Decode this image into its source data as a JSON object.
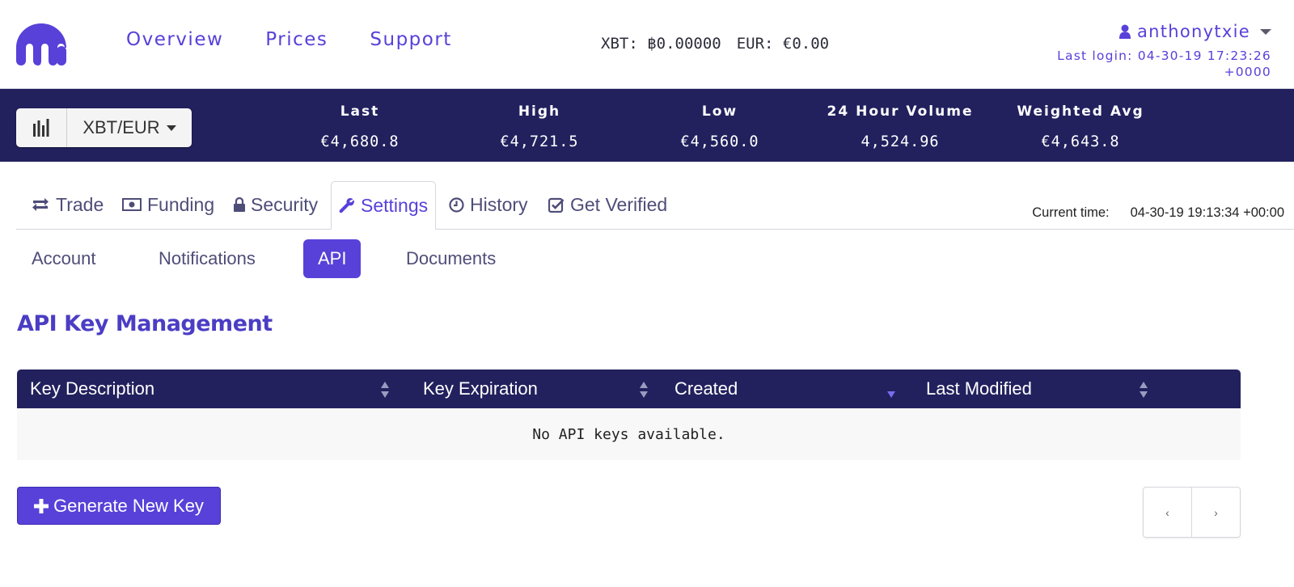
{
  "header": {
    "nav": [
      "Overview",
      "Prices",
      "Support"
    ],
    "balances": {
      "xbt": "XBT: ฿0.00000",
      "eur": "EUR: €0.00"
    },
    "username": "anthonytxie",
    "last_login": "Last login: 04-30-19 17:23:26 +0000"
  },
  "ticker": {
    "pair": "XBT/EUR",
    "stats": [
      {
        "label": "Last",
        "value": "€4,680.8"
      },
      {
        "label": "High",
        "value": "€4,721.5"
      },
      {
        "label": "Low",
        "value": "€4,560.0"
      },
      {
        "label": "24 Hour Volume",
        "value": "4,524.96"
      },
      {
        "label": "Weighted Avg",
        "value": "€4,643.8"
      }
    ]
  },
  "main_tabs": [
    "Trade",
    "Funding",
    "Security",
    "Settings",
    "History",
    "Get Verified"
  ],
  "active_main_tab": "Settings",
  "current_time": {
    "label": "Current time:",
    "value": "04-30-19 19:13:34 +00:00"
  },
  "sub_tabs": [
    "Account",
    "Notifications",
    "API",
    "Documents"
  ],
  "active_sub_tab": "API",
  "section_title": "API Key Management",
  "table": {
    "columns": [
      "Key Description",
      "Key Expiration",
      "Created",
      "Last Modified"
    ],
    "empty_message": "No API keys available."
  },
  "generate_button": "Generate New Key",
  "pager": {
    "prev": "‹",
    "next": "›"
  },
  "colors": {
    "accent": "#5741d9",
    "navy": "#22215e",
    "white": "#ffffff"
  }
}
